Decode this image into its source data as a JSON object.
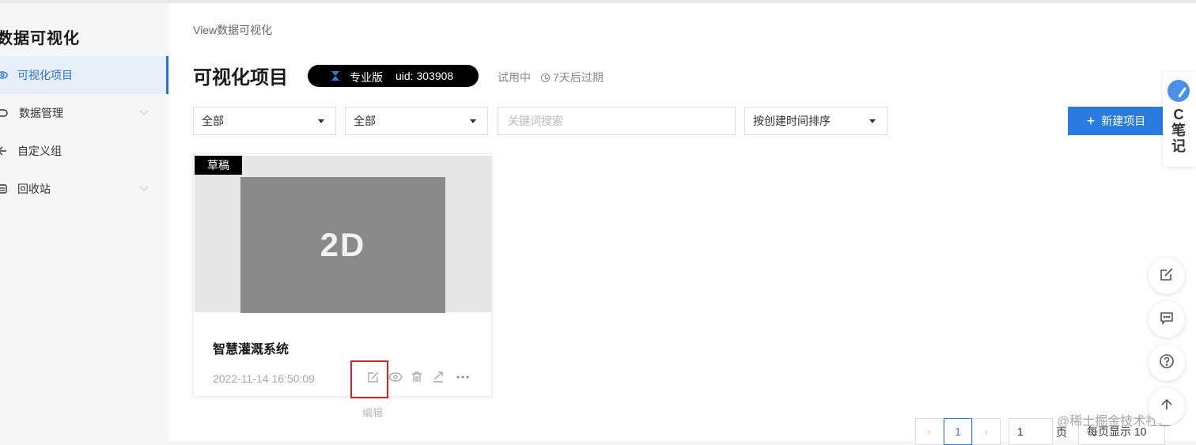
{
  "sidebar": {
    "brand": "数据可视化",
    "items": [
      {
        "label": "可视化项目",
        "icon": "eye-layers-icon",
        "active": true
      },
      {
        "label": "数据管理",
        "icon": "database-icon",
        "expandable": true
      },
      {
        "label": "自定义组",
        "icon": "share-node-icon"
      },
      {
        "label": "回收站",
        "icon": "recycle-icon",
        "expandable": true
      }
    ]
  },
  "header": {
    "breadcrumb": "View数据可视化",
    "title": "可视化项目",
    "badge": {
      "version": "专业版",
      "uid": "uid: 303908"
    },
    "trial": "试用中",
    "expire": "7天后过期"
  },
  "filters": {
    "select1": "全部",
    "select2": "全部",
    "search_placeholder": "关键词搜索",
    "sort": "按创建时间排序",
    "new_button": "新建项目"
  },
  "project": {
    "tag": "草稿",
    "thumb_text": "2D",
    "title": "智慧灌溉系统",
    "date": "2022-11-14 16:50:09",
    "actions": [
      "edit-icon",
      "preview-icon",
      "delete-icon",
      "publish-icon",
      "more-icon"
    ],
    "tooltip": "编辑"
  },
  "pagination": {
    "current": "1",
    "jump_value": "1",
    "page_unit": "页",
    "page_size": "每页显示 10"
  },
  "floating": {
    "csdn_label": "C\n笔\n记",
    "csdn_c": "C",
    "csdn_note1": "笔",
    "csdn_note2": "记",
    "watermark": "@稀土掘金技术社区"
  },
  "colors": {
    "accent": "#2a7ce0",
    "highlight": "#e02020"
  }
}
